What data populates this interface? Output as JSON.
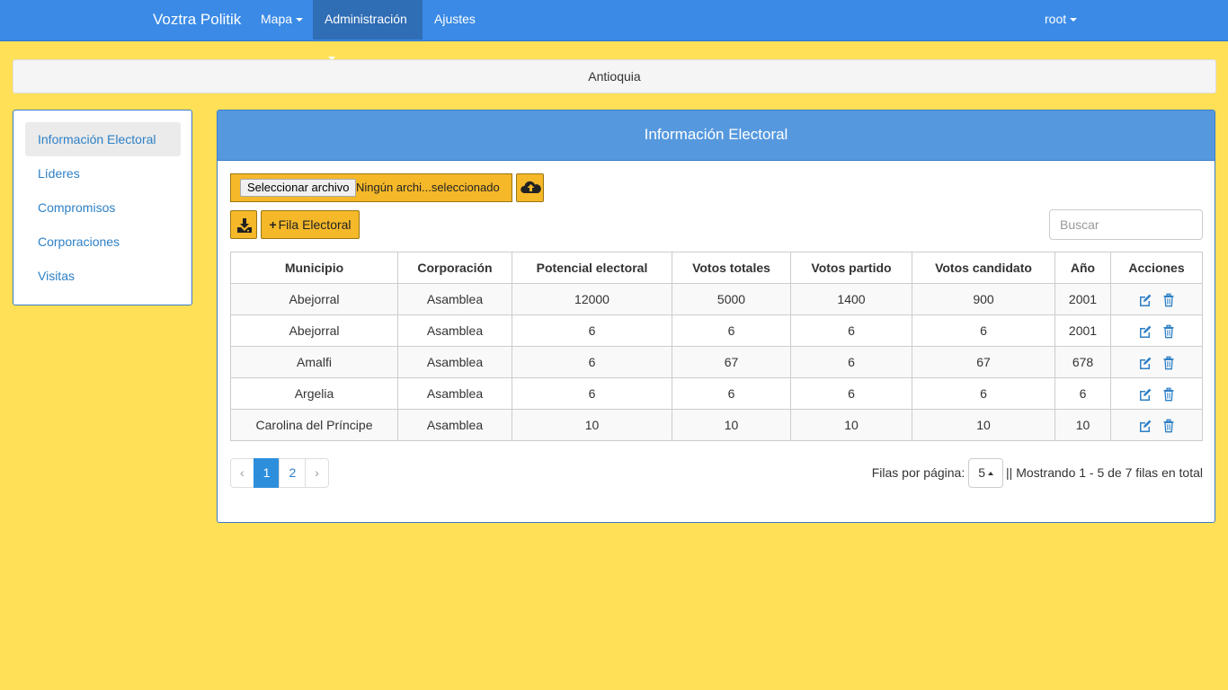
{
  "navbar": {
    "brand": "Voztra Politik",
    "items": [
      {
        "label": "Mapa"
      },
      {
        "label": "Administración"
      },
      {
        "label": "Ajustes"
      }
    ],
    "user": "root",
    "colors": {
      "bar": "#3a8ae6",
      "active": "#2f6db5"
    }
  },
  "breadcrumb": {
    "label": "Antioquia"
  },
  "sidebar": {
    "items": [
      {
        "label": "Información Electoral"
      },
      {
        "label": "Líderes"
      },
      {
        "label": "Compromisos"
      },
      {
        "label": "Corporaciones"
      },
      {
        "label": "Visitas"
      }
    ]
  },
  "panel": {
    "title": "Información Electoral",
    "file": {
      "button_label": "Seleccionar archivo",
      "status": "Ningún archi...seleccionado"
    },
    "upload_icon": "cloud-upload-icon",
    "download_icon": "download-icon",
    "add_button": {
      "icon": "plus-icon",
      "label": "Fila Electoral"
    },
    "search": {
      "placeholder": "Buscar",
      "value": ""
    }
  },
  "table": {
    "headers": [
      "Municipio",
      "Corporación",
      "Potencial electoral",
      "Votos totales",
      "Votos partido",
      "Votos candidato",
      "Año",
      "Acciones"
    ],
    "rows": [
      [
        "Abejorral",
        "Asamblea",
        "12000",
        "5000",
        "1400",
        "900",
        "2001"
      ],
      [
        "Abejorral",
        "Asamblea",
        "6",
        "6",
        "6",
        "6",
        "2001"
      ],
      [
        "Amalfi",
        "Asamblea",
        "6",
        "67",
        "6",
        "67",
        "678"
      ],
      [
        "Argelia",
        "Asamblea",
        "6",
        "6",
        "6",
        "6",
        "6"
      ],
      [
        "Carolina del Príncipe",
        "Asamblea",
        "10",
        "10",
        "10",
        "10",
        "10"
      ]
    ],
    "action_icons": [
      "edit-icon",
      "trash-icon"
    ]
  },
  "pagination": {
    "prev": "‹",
    "pages": [
      "1",
      "2"
    ],
    "next": "›",
    "current": "1"
  },
  "footer": {
    "rows_label": "Filas por página:",
    "rows_value": "5",
    "showing": "|| Mostrando 1 - 5 de 7 filas en total"
  },
  "colors": {
    "background": "#ffe057",
    "accent": "#f5b829",
    "link": "#2d80c6",
    "header": "#5598de"
  }
}
